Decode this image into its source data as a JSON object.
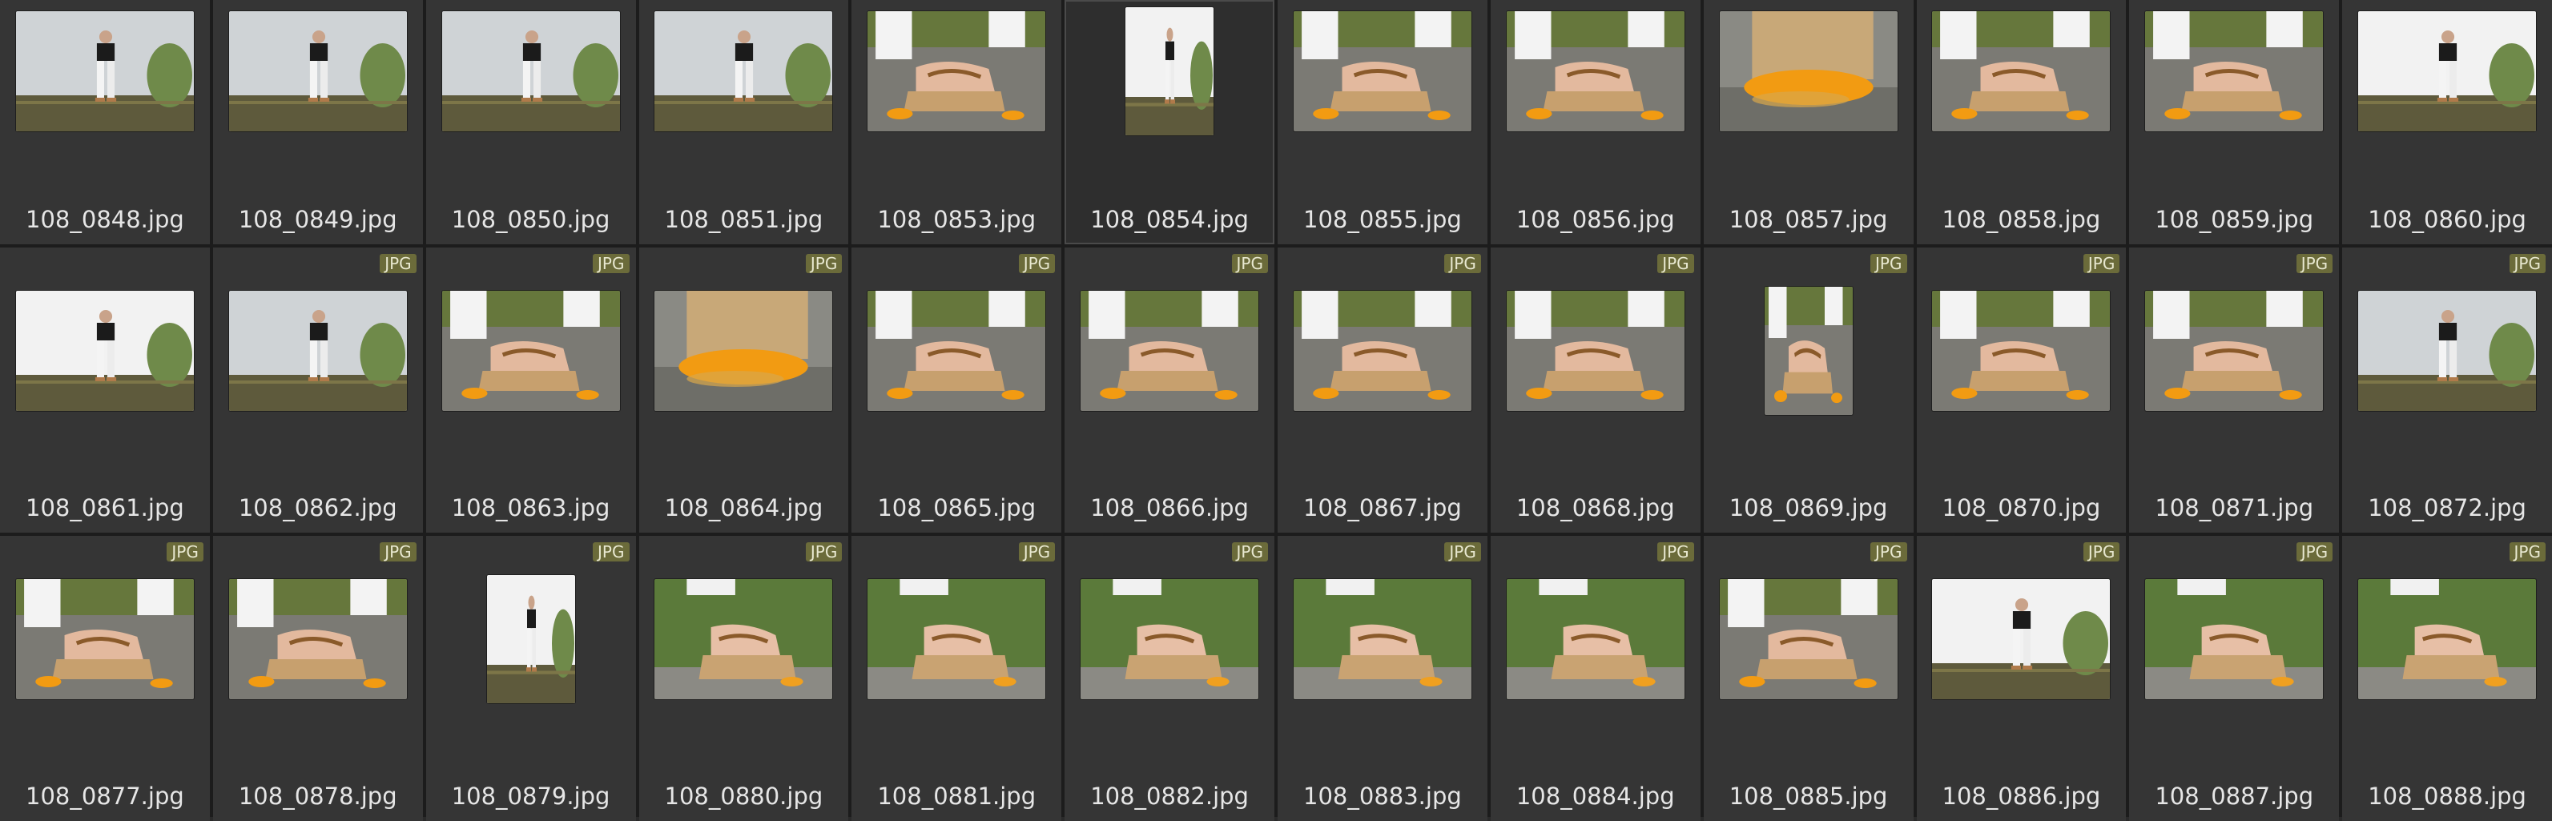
{
  "badge_label": "JPG",
  "rows": [
    [
      {
        "name": "108_0848.jpg",
        "badge": false,
        "scene": "standing",
        "orientation": "landscape"
      },
      {
        "name": "108_0849.jpg",
        "badge": false,
        "scene": "standing",
        "orientation": "landscape"
      },
      {
        "name": "108_0850.jpg",
        "badge": false,
        "scene": "standing",
        "orientation": "landscape"
      },
      {
        "name": "108_0851.jpg",
        "badge": false,
        "scene": "standing",
        "orientation": "landscape"
      },
      {
        "name": "108_0853.jpg",
        "badge": false,
        "scene": "sandal-rock",
        "orientation": "landscape"
      },
      {
        "name": "108_0854.jpg",
        "badge": false,
        "scene": "standing-white",
        "orientation": "portrait",
        "selected": true
      },
      {
        "name": "108_0855.jpg",
        "badge": false,
        "scene": "sandal-closeup",
        "orientation": "landscape"
      },
      {
        "name": "108_0856.jpg",
        "badge": false,
        "scene": "sandal-rock",
        "orientation": "landscape"
      },
      {
        "name": "108_0857.jpg",
        "badge": false,
        "scene": "cork-orange",
        "orientation": "landscape"
      },
      {
        "name": "108_0858.jpg",
        "badge": false,
        "scene": "sandal-rock",
        "orientation": "landscape"
      },
      {
        "name": "108_0859.jpg",
        "badge": false,
        "scene": "sandal-rock",
        "orientation": "landscape"
      },
      {
        "name": "108_0860.jpg",
        "badge": false,
        "scene": "standing-white",
        "orientation": "landscape"
      }
    ],
    [
      {
        "name": "108_0861.jpg",
        "badge": false,
        "scene": "standing-white",
        "orientation": "landscape"
      },
      {
        "name": "108_0862.jpg",
        "badge": true,
        "scene": "standing",
        "orientation": "landscape"
      },
      {
        "name": "108_0863.jpg",
        "badge": true,
        "scene": "sandal-closeup",
        "orientation": "landscape"
      },
      {
        "name": "108_0864.jpg",
        "badge": true,
        "scene": "cork-orange",
        "orientation": "landscape"
      },
      {
        "name": "108_0865.jpg",
        "badge": true,
        "scene": "sandal-rock",
        "orientation": "landscape"
      },
      {
        "name": "108_0866.jpg",
        "badge": true,
        "scene": "sandal-rock",
        "orientation": "landscape"
      },
      {
        "name": "108_0867.jpg",
        "badge": true,
        "scene": "sandal-closeup",
        "orientation": "landscape"
      },
      {
        "name": "108_0868.jpg",
        "badge": true,
        "scene": "sandal-rock",
        "orientation": "landscape"
      },
      {
        "name": "108_0869.jpg",
        "badge": true,
        "scene": "sandal-rock",
        "orientation": "portrait"
      },
      {
        "name": "108_0870.jpg",
        "badge": true,
        "scene": "sandal-rock",
        "orientation": "landscape"
      },
      {
        "name": "108_0871.jpg",
        "badge": true,
        "scene": "sandal-rock",
        "orientation": "landscape"
      },
      {
        "name": "108_0872.jpg",
        "badge": true,
        "scene": "standing",
        "orientation": "landscape"
      }
    ],
    [
      {
        "name": "108_0877.jpg",
        "badge": true,
        "scene": "sandal-rock",
        "orientation": "landscape"
      },
      {
        "name": "108_0878.jpg",
        "badge": true,
        "scene": "sandal-rock",
        "orientation": "landscape"
      },
      {
        "name": "108_0879.jpg",
        "badge": true,
        "scene": "standing-white",
        "orientation": "portrait"
      },
      {
        "name": "108_0880.jpg",
        "badge": true,
        "scene": "sandal-grass",
        "orientation": "landscape"
      },
      {
        "name": "108_0881.jpg",
        "badge": true,
        "scene": "sandal-grass",
        "orientation": "landscape"
      },
      {
        "name": "108_0882.jpg",
        "badge": true,
        "scene": "sandal-grass",
        "orientation": "landscape"
      },
      {
        "name": "108_0883.jpg",
        "badge": true,
        "scene": "sandal-grass",
        "orientation": "landscape"
      },
      {
        "name": "108_0884.jpg",
        "badge": true,
        "scene": "sandal-grass",
        "orientation": "landscape"
      },
      {
        "name": "108_0885.jpg",
        "badge": true,
        "scene": "sandal-rock",
        "orientation": "landscape"
      },
      {
        "name": "108_0886.jpg",
        "badge": true,
        "scene": "standing-white",
        "orientation": "landscape"
      },
      {
        "name": "108_0887.jpg",
        "badge": true,
        "scene": "sandal-grass",
        "orientation": "landscape"
      },
      {
        "name": "108_0888.jpg",
        "badge": true,
        "scene": "sandal-grass",
        "orientation": "landscape"
      }
    ]
  ],
  "colors": {
    "background": "#2a2a2a",
    "cell": "#353535",
    "badge_bg": "#6b6b3a",
    "label_text": "#e6e6e6"
  }
}
